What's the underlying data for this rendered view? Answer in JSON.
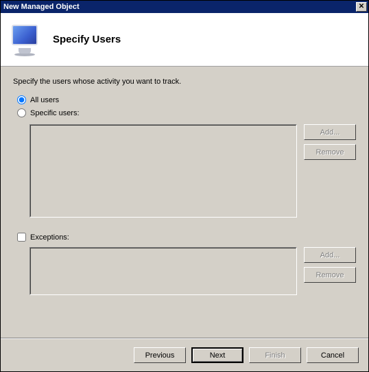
{
  "window": {
    "title": "New Managed Object"
  },
  "header": {
    "title": "Specify Users"
  },
  "content": {
    "instruction": "Specify the users whose activity you want to track.",
    "radio_all": "All users",
    "radio_specific": "Specific users:",
    "exceptions_label": "Exceptions:"
  },
  "buttons": {
    "add": "Add...",
    "remove": "Remove"
  },
  "footer": {
    "previous": "Previous",
    "next": "Next",
    "finish": "Finish",
    "cancel": "Cancel"
  },
  "close_glyph": "✕"
}
